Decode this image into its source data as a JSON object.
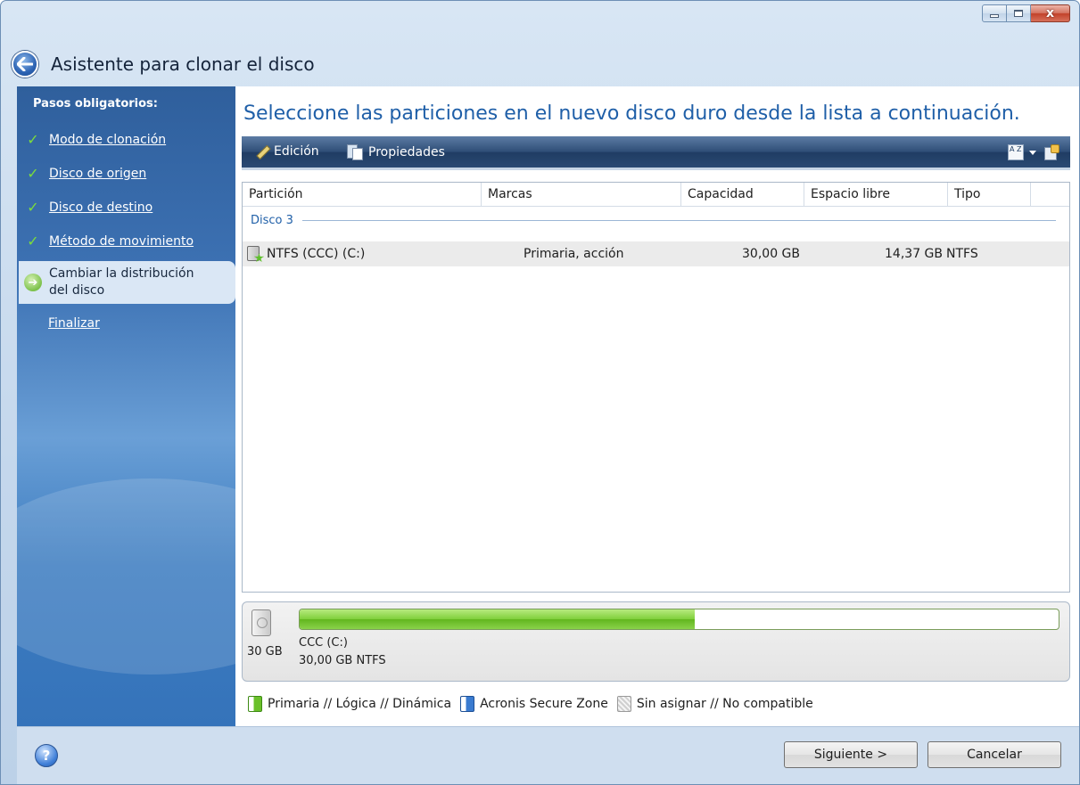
{
  "window": {
    "title": "Asistente para clonar el disco",
    "controls": {
      "minimize_icon": "minimize-icon",
      "maximize_icon": "maximize-icon",
      "close_glyph": "x"
    }
  },
  "sidebar": {
    "heading": "Pasos obligatorios:",
    "completed_steps": [
      {
        "label": "Modo de clonación",
        "check": "✓"
      },
      {
        "label": "Disco de origen",
        "check": "✓"
      },
      {
        "label": "Disco de destino",
        "check": "✓"
      },
      {
        "label": "Método de movimiento",
        "check": "✓"
      }
    ],
    "current_step": {
      "line1": "Cambiar la distribución",
      "line2": "del disco",
      "arrow": "➔"
    },
    "next_step": "Finalizar"
  },
  "main": {
    "heading": "Seleccione las particiones en el nuevo disco duro desde la lista a continuación.",
    "toolbar": {
      "edit_label": "Edición",
      "properties_label": "Propiedades",
      "sort_glyph": "A Z"
    },
    "table": {
      "columns": [
        "Partición",
        "Marcas",
        "Capacidad",
        "Espacio libre",
        "Tipo"
      ],
      "group_label": "Disco 3",
      "rows": [
        {
          "partition": "NTFS (CCC) (C:)",
          "flags": "Primaria, acción",
          "capacity": "30,00 GB",
          "free": "14,37 GB",
          "type": "NTFS"
        }
      ]
    },
    "disk_map": {
      "disk_size": "30 GB",
      "partition_name": "CCC (C:)",
      "partition_info": "30,00 GB  NTFS",
      "used_fraction": 0.52
    },
    "legend": [
      {
        "label": "Primaria // Lógica // Dinámica",
        "kind": "primary"
      },
      {
        "label": "Acronis Secure Zone",
        "kind": "secure"
      },
      {
        "label": "Sin asignar // No compatible",
        "kind": "unalloc"
      }
    ]
  },
  "footer": {
    "help_glyph": "?",
    "next_label": "Siguiente >",
    "cancel_label": "Cancelar"
  },
  "colors": {
    "accent_blue": "#1f5fa8",
    "partition_green": "#6ac02a",
    "secure_blue": "#3a7bd0"
  }
}
